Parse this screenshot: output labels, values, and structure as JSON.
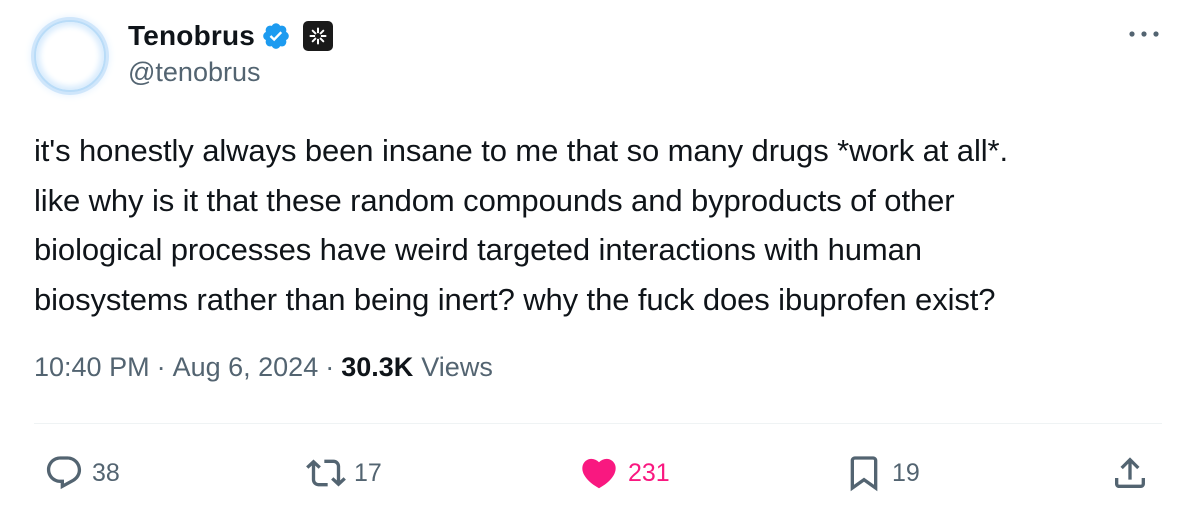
{
  "author": {
    "display_name": "Tenobrus",
    "handle": "@tenobrus",
    "avatar_icon": "avatar-circle-icon",
    "verified_color": "#1d9bf0"
  },
  "tweet": {
    "lines": [
      "it's honestly always been insane to me that so many drugs *work at all*.",
      "like why is it that these random compounds and byproducts of other",
      "biological processes have weird targeted interactions with human",
      "biosystems rather than being inert? why the fuck does ibuprofen exist?"
    ]
  },
  "meta": {
    "time": "10:40 PM",
    "separator": "·",
    "date": "Aug 6, 2024",
    "views_count": "30.3K",
    "views_label": "Views"
  },
  "actions": {
    "replies": "38",
    "reposts": "17",
    "likes": "231",
    "bookmarks": "19"
  },
  "colors": {
    "like": "#f91880",
    "secondary_text": "#536471",
    "primary_text": "#0f1419"
  }
}
